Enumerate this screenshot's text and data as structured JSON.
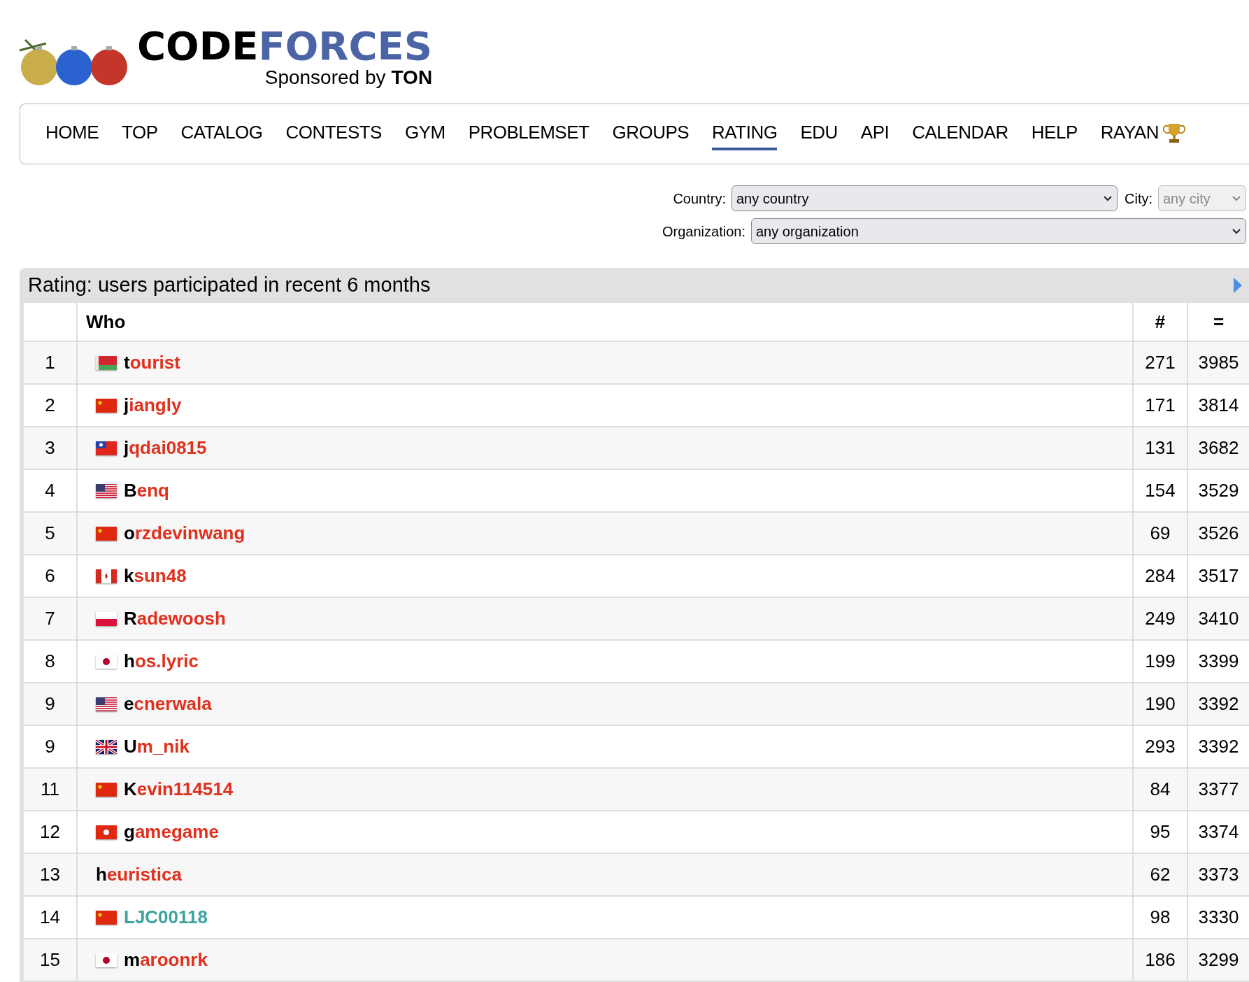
{
  "logo": {
    "word_dark": "CODE",
    "word_blue": "FORCES",
    "sponsor": "Sponsored by",
    "sponsor_name": "TON"
  },
  "nav": [
    {
      "label": "HOME",
      "selected": false,
      "kind": "link"
    },
    {
      "label": "TOP",
      "selected": false,
      "kind": "link"
    },
    {
      "label": "CATALOG",
      "selected": false,
      "kind": "link"
    },
    {
      "label": "CONTESTS",
      "selected": false,
      "kind": "link"
    },
    {
      "label": "GYM",
      "selected": false,
      "kind": "link"
    },
    {
      "label": "PROBLEMSET",
      "selected": false,
      "kind": "link"
    },
    {
      "label": "GROUPS",
      "selected": false,
      "kind": "link"
    },
    {
      "label": "RATING",
      "selected": true,
      "kind": "link"
    },
    {
      "label": "EDU",
      "selected": false,
      "kind": "link"
    },
    {
      "label": "API",
      "selected": false,
      "kind": "link"
    },
    {
      "label": "CALENDAR",
      "selected": false,
      "kind": "link"
    },
    {
      "label": "HELP",
      "selected": false,
      "kind": "link"
    },
    {
      "label": "RAYAN",
      "selected": false,
      "kind": "trophy"
    }
  ],
  "filters": {
    "country_label": "Country:",
    "country_value": "any country",
    "city_label": "City:",
    "city_value": "any city",
    "city_disabled": true,
    "organization_label": "Organization:",
    "organization_value": "any organization"
  },
  "table": {
    "title": "Rating: users participated in recent 6 months",
    "columns": [
      "Who",
      "#",
      "="
    ],
    "rows": [
      {
        "rank": "1",
        "kind": "belarus",
        "handle": "tourist",
        "legendary": true,
        "color": "#e0301e",
        "contests": "271",
        "rating": "3985"
      },
      {
        "rank": "2",
        "kind": "china",
        "handle": "jiangly",
        "legendary": true,
        "color": "#e0301e",
        "contests": "171",
        "rating": "3814"
      },
      {
        "rank": "3",
        "kind": "taiwan",
        "handle": "jqdai0815",
        "legendary": true,
        "color": "#e0301e",
        "contests": "131",
        "rating": "3682"
      },
      {
        "rank": "4",
        "kind": "usa",
        "handle": "Benq",
        "legendary": true,
        "color": "#e0301e",
        "contests": "154",
        "rating": "3529"
      },
      {
        "rank": "5",
        "kind": "china",
        "handle": "orzdevinwang",
        "legendary": true,
        "color": "#e0301e",
        "contests": "69",
        "rating": "3526"
      },
      {
        "rank": "6",
        "kind": "canada",
        "handle": "ksun48",
        "legendary": true,
        "color": "#e0301e",
        "contests": "284",
        "rating": "3517"
      },
      {
        "rank": "7",
        "kind": "poland",
        "handle": "Radewoosh",
        "legendary": true,
        "color": "#e0301e",
        "contests": "249",
        "rating": "3410"
      },
      {
        "rank": "8",
        "kind": "japan",
        "handle": "hos.lyric",
        "legendary": true,
        "color": "#e0301e",
        "contests": "199",
        "rating": "3399"
      },
      {
        "rank": "9",
        "kind": "usa",
        "handle": "ecnerwala",
        "legendary": true,
        "color": "#e0301e",
        "contests": "190",
        "rating": "3392"
      },
      {
        "rank": "9",
        "kind": "uk",
        "handle": "Um_nik",
        "legendary": true,
        "color": "#e0301e",
        "contests": "293",
        "rating": "3392"
      },
      {
        "rank": "11",
        "kind": "china",
        "handle": "Kevin114514",
        "legendary": true,
        "color": "#e0301e",
        "contests": "84",
        "rating": "3377"
      },
      {
        "rank": "12",
        "kind": "hongkong",
        "handle": "gamegame",
        "legendary": true,
        "color": "#e0301e",
        "contests": "95",
        "rating": "3374"
      },
      {
        "rank": "13",
        "kind": "noflag",
        "handle": "heuristica",
        "legendary": true,
        "color": "#e0301e",
        "contests": "62",
        "rating": "3373"
      },
      {
        "rank": "14",
        "kind": "china",
        "handle": "LJC00118",
        "legendary": false,
        "color": "#3ea39f",
        "contests": "98",
        "rating": "3330"
      },
      {
        "rank": "15",
        "kind": "japan",
        "handle": "maroonrk",
        "legendary": true,
        "color": "#e0301e",
        "contests": "186",
        "rating": "3299"
      }
    ]
  }
}
